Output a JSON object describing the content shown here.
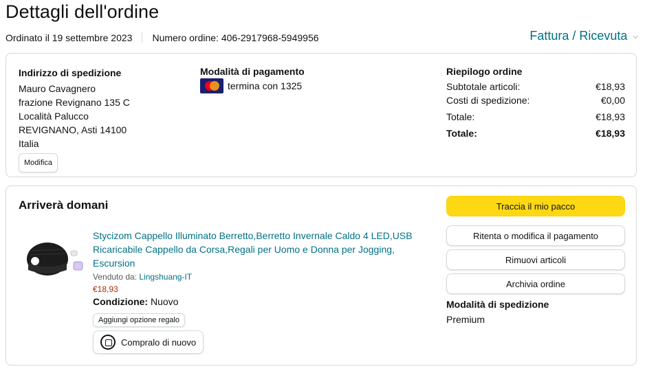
{
  "header": {
    "title": "Dettagli dell'ordine",
    "ordered_on": "Ordinato il 19 settembre 2023",
    "order_number": "Numero ordine: 406-2917968-5949956",
    "invoice_link": "Fattura / Ricevuta"
  },
  "shipping_address": {
    "heading": "Indirizzo di spedizione",
    "lines": [
      "Mauro Cavagnero",
      "frazione Revignano 135 C",
      "Località Palucco",
      "REVIGNANO, Asti 14100",
      "Italia"
    ],
    "edit_label": "Modifica"
  },
  "payment": {
    "heading": "Modalità di pagamento",
    "card_text": "termina con 1325",
    "card_icon": "mastercard-icon"
  },
  "summary": {
    "heading": "Riepilogo ordine",
    "rows": [
      {
        "label": "Subtotale articoli:",
        "value": "€18,93"
      },
      {
        "label": "Costi di spedizione:",
        "value": "€0,00"
      },
      {
        "label": "Totale:",
        "value": "€18,93"
      }
    ],
    "grand_total_label": "Totale:",
    "grand_total_value": "€18,93"
  },
  "shipment": {
    "status": "Arriverà domani",
    "product": {
      "title": "Stycizom Cappello Illuminato Berretto,Berretto Invernale Caldo 4 LED,USB Ricaricabile Cappello da Corsa,Regali per Uomo e Donna per Jogging, Escursion",
      "sold_by_label": "Venduto da:",
      "seller": "Lingshuang-IT",
      "price": "€18,93",
      "condition_label": "Condizione:",
      "condition": "Nuovo",
      "gift_label": "Aggiungi opzione regalo",
      "rebuy_label": "Compralo di nuovo"
    },
    "actions": {
      "track": "Traccia il mio pacco",
      "retry_payment": "Ritenta o modifica il pagamento",
      "remove_items": "Rimuovi articoli",
      "archive": "Archivia ordine"
    },
    "shipping_method_heading": "Modalità di spedizione",
    "shipping_method": "Premium"
  },
  "colors": {
    "link": "#007185",
    "price": "#b12704",
    "track_button": "#ffd814"
  }
}
